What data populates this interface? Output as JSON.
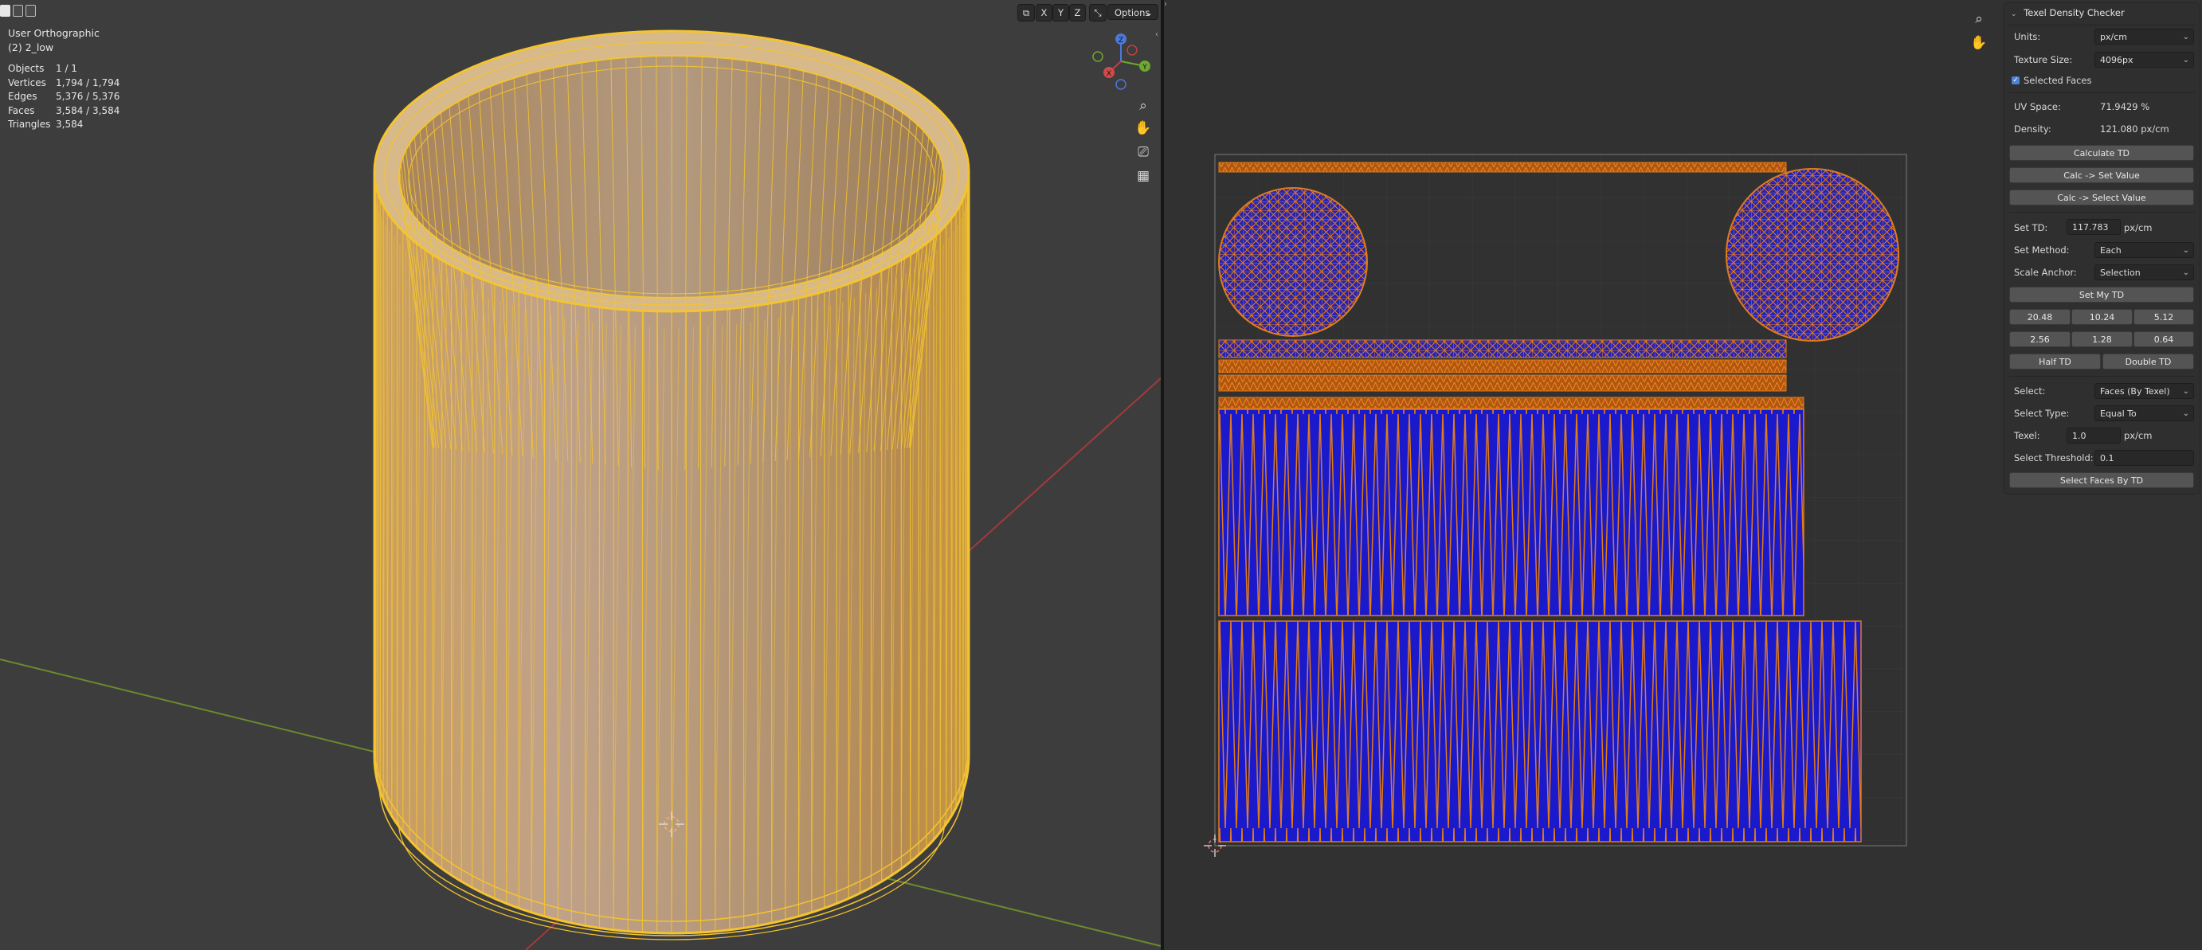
{
  "viewport": {
    "view_name": "User Orthographic",
    "object_name": "(2) 2_low",
    "stats": [
      {
        "key": "Objects",
        "value": "1 / 1"
      },
      {
        "key": "Vertices",
        "value": "1,794 / 1,794"
      },
      {
        "key": "Edges",
        "value": "5,376 / 5,376"
      },
      {
        "key": "Faces",
        "value": "3,584 / 3,584"
      },
      {
        "key": "Triangles",
        "value": "3,584"
      }
    ],
    "header": {
      "x": "X",
      "y": "Y",
      "z": "Z",
      "options": "Options"
    },
    "gizmo": {
      "x": "X",
      "y": "Y",
      "z": "Z"
    }
  },
  "panel": {
    "title": "Texel Density Checker",
    "units_label": "Units:",
    "units_value": "px/cm",
    "texture_size_label": "Texture Size:",
    "texture_size_value": "4096px",
    "selected_faces_label": "Selected Faces",
    "selected_faces_checked": true,
    "uv_space_label": "UV Space:",
    "uv_space_value": "71.9429 %",
    "density_label": "Density:",
    "density_value": "121.080 px/cm",
    "calculate_td": "Calculate TD",
    "calc_set_value": "Calc -> Set Value",
    "calc_select_value": "Calc -> Select Value",
    "set_td_label": "Set TD:",
    "set_td_value": "117.783",
    "set_td_unit": "px/cm",
    "set_method_label": "Set Method:",
    "set_method_value": "Each",
    "scale_anchor_label": "Scale Anchor:",
    "scale_anchor_value": "Selection",
    "set_my_td": "Set My TD",
    "presets_row1": [
      "20.48",
      "10.24",
      "5.12"
    ],
    "presets_row2": [
      "2.56",
      "1.28",
      "0.64"
    ],
    "half_td": "Half TD",
    "double_td": "Double TD",
    "select_label": "Select:",
    "select_value": "Faces (By Texel)",
    "select_type_label": "Select Type:",
    "select_type_value": "Equal To",
    "texel_label": "Texel:",
    "texel_value": "1.0",
    "texel_unit": "px/cm",
    "select_threshold_label": "Select Threshold:",
    "select_threshold_value": "0.1",
    "select_faces_by_td": "Select Faces By TD"
  },
  "colors": {
    "viewport_bg": "#3d3d3d",
    "uv_bg": "#313131",
    "wire_selected": "#f4c430",
    "uv_island_fill": "#1a1ac8",
    "uv_edge": "#e07b1a"
  }
}
